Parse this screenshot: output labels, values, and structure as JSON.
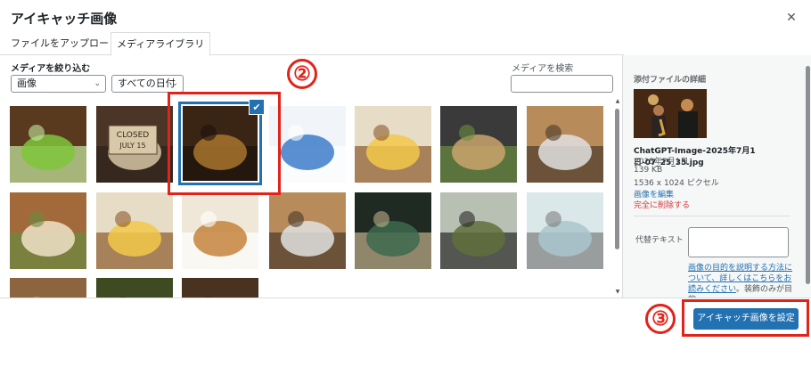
{
  "modal": {
    "title": "アイキャッチ画像",
    "close_icon": "close-icon"
  },
  "tabs": [
    {
      "label": "ファイルをアップロード"
    },
    {
      "label": "メディアライブラリ"
    }
  ],
  "filters": {
    "label": "メディアを絞り込む",
    "media_type": "画像",
    "date": "すべての日付"
  },
  "search": {
    "label": "メディアを検索",
    "value": ""
  },
  "grid": {
    "items": [
      {
        "name": "green-drink-thumbnail",
        "colors": [
          "#5a3a1f",
          "#7fc63b",
          "#c6e9a0"
        ]
      },
      {
        "name": "closed-sign-thumbnail",
        "colors": [
          "#4a3526",
          "#d6c6a6",
          "#2e231b"
        ],
        "text": "CLOSED\nJULY 15"
      },
      {
        "name": "jazz-saxophone-thumbnail",
        "colors": [
          "#3a2414",
          "#a8742d",
          "#1a120c"
        ],
        "selected": true
      },
      {
        "name": "website-screenshot-thumbnail",
        "colors": [
          "#f1f4f8",
          "#3d7cc9",
          "#ffffff"
        ]
      },
      {
        "name": "curry-bowl-thumbnail",
        "colors": [
          "#e7dcc6",
          "#f2c84a",
          "#8a5a2b"
        ]
      },
      {
        "name": "sandwich-thumbnail",
        "colors": [
          "#3a3a3a",
          "#caa46c",
          "#6a8d3e"
        ]
      },
      {
        "name": "menu-board-thumbnail",
        "colors": [
          "#b88b5a",
          "#e0e0e0",
          "#4a3a2a"
        ]
      },
      {
        "name": "sandwich-wrap-thumbnail",
        "colors": [
          "#a26a3a",
          "#f0e2c8",
          "#6a8a3e"
        ]
      },
      {
        "name": "curry-bowl-2-thumbnail",
        "colors": [
          "#e7dcc6",
          "#f2c84a",
          "#8a5a2b"
        ]
      },
      {
        "name": "curry-rice-thumbnail",
        "colors": [
          "#efe7d8",
          "#c4843c",
          "#ffffff"
        ]
      },
      {
        "name": "menu-board-2-thumbnail",
        "colors": [
          "#b88b5a",
          "#e0e0e0",
          "#4a3a2a"
        ]
      },
      {
        "name": "dark-menu-poster-thumbnail",
        "colors": [
          "#1e2a22",
          "#3d6a4d",
          "#bfae8a"
        ]
      },
      {
        "name": "horse-field-thumbnail",
        "colors": [
          "#b8bfb3",
          "#5f6f3c",
          "#2a2a2a"
        ]
      },
      {
        "name": "bath-thumbnail",
        "colors": [
          "#dbe8ea",
          "#a9c6cc",
          "#7e7e7e"
        ]
      },
      {
        "name": "partial-thumbnail-1",
        "colors": [
          "#8d6440",
          "#5a3a26",
          "#c8a07a"
        ]
      },
      {
        "name": "partial-thumbnail-2",
        "colors": [
          "#3e4a22",
          "#a9a032",
          "#2b2a16"
        ]
      },
      {
        "name": "partial-thumbnail-3",
        "colors": [
          "#4a3220",
          "#7c5a3a",
          "#2a1c12"
        ]
      }
    ]
  },
  "details": {
    "heading": "添付ファイルの詳細",
    "filename": "ChatGPT-Image-2025年7月1日-07_25_35.jpg",
    "date": "2025年7月1日",
    "size": "139 KB",
    "dimensions": "1536 x 1024 ピクセル",
    "edit_link": "画像を編集",
    "delete_link": "完全に削除する",
    "alt_label": "代替テキスト",
    "alt_value": "",
    "help_link": "画像の目的を説明する方法について、詳しくはこちらをお読みください",
    "help_suffix": "。装飾のみが目的"
  },
  "footer": {
    "set_button": "アイキャッチ画像を設定"
  },
  "annotations": {
    "step2": "②",
    "step3": "③",
    "color": "#e2231a"
  },
  "colors": {
    "accent": "#2271b1",
    "danger": "#d63638"
  }
}
